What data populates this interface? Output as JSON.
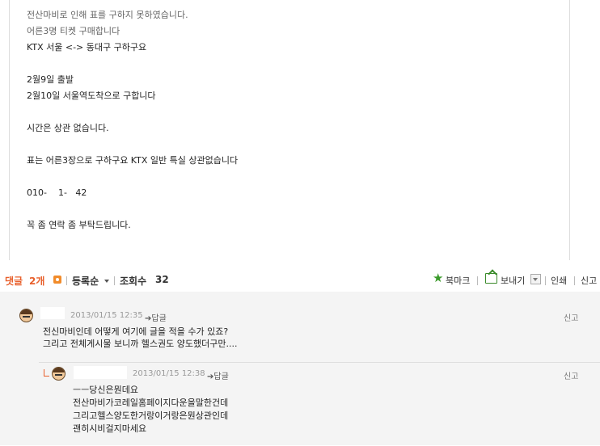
{
  "post": {
    "lines": [
      "전산마비로 인해 표를 구하지 못하였습니다.",
      "어른3명 티켓 구매합니다",
      "KTX 서울 <-> 동대구 구하구요",
      "2월9일 출발",
      "2월10일 서울역도착으로 구합니다",
      "시간은 상관 없습니다.",
      "표는 어른3장으로 구하구요 KTX 일반 특실 상관없습니다",
      "010-    1-   42",
      "꼭 좀 연락 좀 부탁드립니다."
    ]
  },
  "toolbar": {
    "comments_label": "댓글",
    "comments_count": "2개",
    "sort_label": "등록순",
    "views_label": "조회수",
    "views_count": "32",
    "bookmark": "북마크",
    "send": "보내기",
    "print": "인쇄",
    "report": "신고"
  },
  "comments": [
    {
      "author": "",
      "date": "2013/01/15 12:35",
      "reply_label": "답글",
      "report": "신고",
      "lines": [
        "전신마비인데 어떻게 여기에 글을 적을 수가 있죠?",
        "그리고 전체게시물 보니까 헬스권도 양도했더구만...."
      ],
      "replies": [
        {
          "author": "",
          "date": "2013/01/15 12:38",
          "reply_label": "답글",
          "report": "신고",
          "lines": [
            "ㅡㅡ당신은뭔데요",
            "전산마비가코레일홈페이지다운을말한건데",
            "그리고헬스양도한거랑이거랑은뭔상관인데",
            "괜히시비걸지마세요"
          ]
        }
      ]
    }
  ],
  "colors": {
    "accent": "#e8602c",
    "comment_bg": "#f4f4f4",
    "icon_green": "#3a9a2a"
  }
}
